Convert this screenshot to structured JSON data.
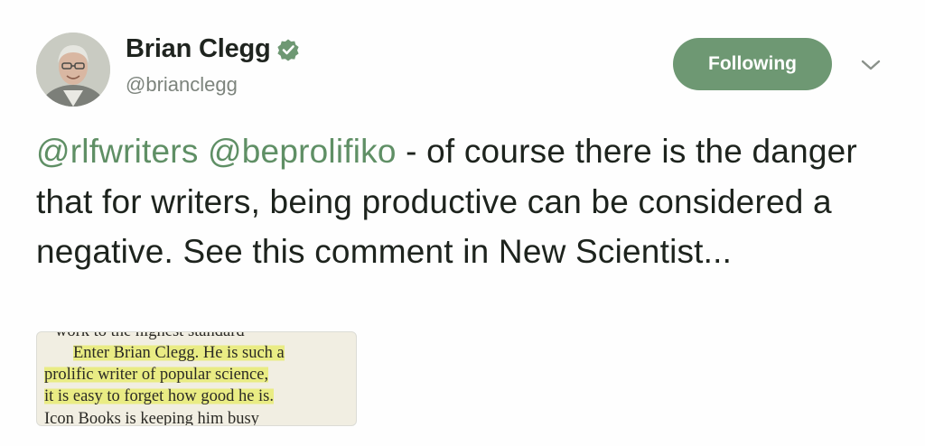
{
  "user": {
    "name": "Brian Clegg",
    "handle": "@brianclegg"
  },
  "follow_button": {
    "label": "Following"
  },
  "tweet": {
    "mention_1": "@rlfwriters",
    "mention_2": "@beprolifiko",
    "text": " - of course there is the danger that for writers, being productive can be considered a negative. See this comment in New Scientist..."
  },
  "media": {
    "lines": [
      "work to the highest standard",
      "Enter Brian Clegg. He is such a",
      "prolific writer of popular science,",
      "it is easy to forget how good he is.",
      "Icon Books is keeping him busy"
    ]
  },
  "colors": {
    "accent": "#6e9873",
    "mention": "#5f8f65",
    "highlight": "#e8ec74"
  },
  "icons": {
    "verified": "verified-badge-icon",
    "chevron": "chevron-down-icon"
  }
}
